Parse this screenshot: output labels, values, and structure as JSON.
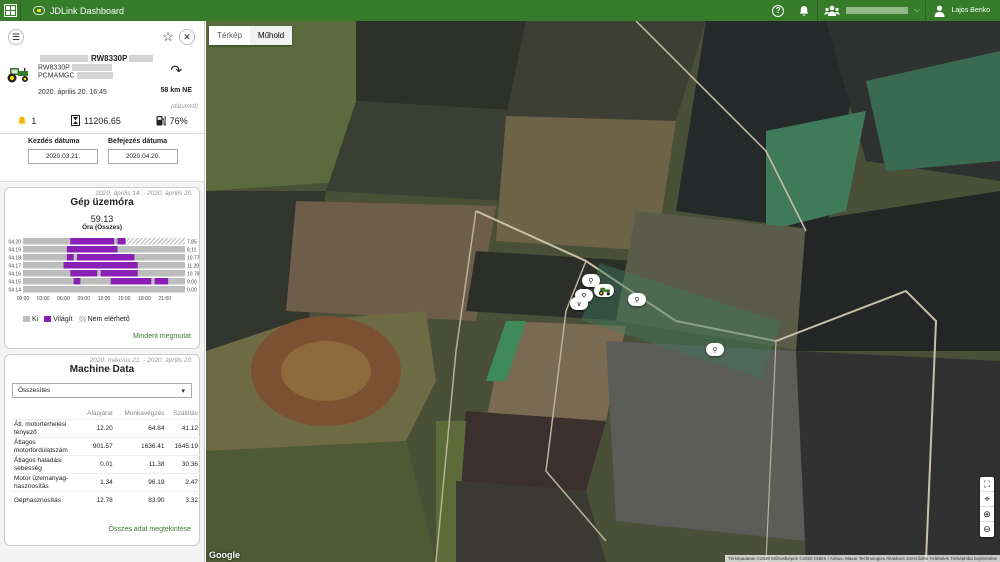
{
  "app": {
    "title": "JDLink Dashboard"
  },
  "header": {
    "user_name": "Lajos Benko"
  },
  "machine": {
    "title": "RW8330P",
    "model": "RW8330P",
    "line2": "PCMAMGC",
    "datetime": "2020. április 20. 16:45",
    "direction_text": "58 km NE",
    "datum_note": "(dátumtól)",
    "alerts": "1",
    "engine_hours": "11206.65",
    "fuel": "76%"
  },
  "dates": {
    "start_label": "Kezdés dátuma",
    "start_value": "2020.03.21.",
    "end_label": "Befejezés dátuma",
    "end_value": "2020.04.20."
  },
  "utilization": {
    "range": "2020. április 14. - 2020. április 20.",
    "title": "Gép üzemóra",
    "total": "59.13",
    "total_label": "Óra (Összes)",
    "legend_off": "Ki",
    "legend_on": "Világít",
    "legend_na": "Nem elérhető",
    "show_all": "Mindent megmutat",
    "colors": {
      "on": "#8a1fb5",
      "off": "#bdbdbd",
      "na": "#e7e7e7"
    }
  },
  "chart_data": {
    "type": "bar",
    "title": "Gép üzemóra",
    "categories": [
      "04.20",
      "04.19",
      "04.18",
      "04.17",
      "04.16",
      "04.15",
      "04.14"
    ],
    "values": [
      7.85,
      8.11,
      10.77,
      11.2,
      10.79,
      9.0,
      0.0
    ],
    "x_ticks": [
      "00:00",
      "03:00",
      "06:00",
      "09:00",
      "12:00",
      "15:00",
      "18:00",
      "21:00"
    ],
    "on_ranges": [
      [
        [
          7.0,
          13.5
        ],
        [
          14.0,
          15.2
        ]
      ],
      [
        [
          6.5,
          14.0
        ]
      ],
      [
        [
          6.5,
          7.5
        ],
        [
          8.0,
          16.5
        ]
      ],
      [
        [
          6.0,
          17.0
        ]
      ],
      [
        [
          7.0,
          11.0
        ],
        [
          11.5,
          17.0
        ]
      ],
      [
        [
          7.5,
          8.5
        ],
        [
          13.0,
          19.0
        ],
        [
          19.5,
          21.5
        ]
      ],
      []
    ],
    "na_ranges": [
      [
        [
          15.2,
          24.0
        ]
      ],
      [],
      [],
      [],
      [],
      [],
      []
    ]
  },
  "machine_data": {
    "range": "2020. március 21. - 2020. április 20.",
    "title": "Machine Data",
    "select_value": "Összesítés",
    "columns": [
      "Alapjárat",
      "Munkavégzés",
      "Szállítás"
    ],
    "rows": [
      {
        "label": "Átl. motorterhelési tényező",
        "values": [
          "12.20",
          "64.84",
          "41.12"
        ]
      },
      {
        "label": "Átlagos motorfordulatszám",
        "values": [
          "901.57",
          "1636.41",
          "1645.19"
        ]
      },
      {
        "label": "Átlagos haladási sebesség",
        "values": [
          "0.01",
          "11.38",
          "30.36"
        ]
      },
      {
        "label": "Motor üzemanyag-hasznosítás",
        "values": [
          "1.34",
          "96.19",
          "2.47"
        ]
      },
      {
        "label": "Géphasznosítás",
        "values": [
          "12.78",
          "83.90",
          "3.32"
        ]
      }
    ],
    "show_all": "Összes adat megtekintése"
  },
  "map": {
    "tab_map": "Térkép",
    "tab_satellite": "Műhold",
    "google": "Google",
    "attribution": "Térképadatok ©2020 Műholdképek ©2020 CNES / Airbus, Maxar Technologies   Általános Szerződési Feltételek   Térképhiba bejelentése"
  },
  "icons": {
    "apps": "apps-icon",
    "help": "help-icon",
    "bell": "bell-icon",
    "org": "org-icon",
    "user": "user-icon",
    "menu": "menu-icon",
    "star": "star-icon",
    "close": "close-icon",
    "direction": "direction-icon",
    "alert": "bell-icon",
    "hours": "hourglass-icon",
    "fuel": "fuel-icon"
  }
}
